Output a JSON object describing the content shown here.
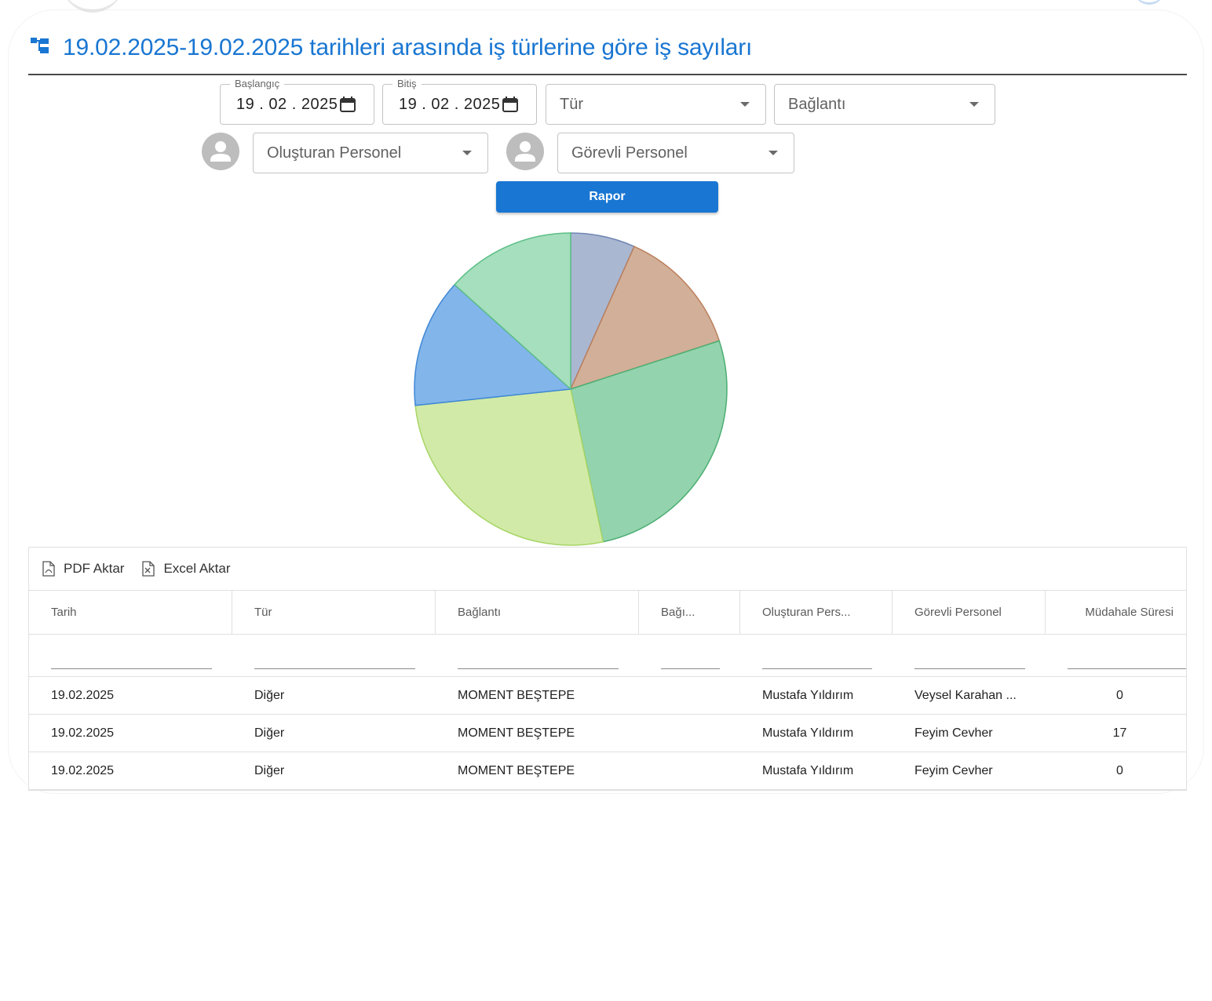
{
  "header": {
    "title": "19.02.2025-19.02.2025 tarihleri arasında iş türlerine göre iş sayıları",
    "icon": "hierarchy-icon"
  },
  "filters": {
    "start_label": "Başlangıç",
    "start_value": "19 . 02 . 2025",
    "end_label": "Bitiş",
    "end_value": "19 . 02 . 2025",
    "type_placeholder": "Tür",
    "connection_placeholder": "Bağlantı",
    "creator_placeholder": "Oluşturan Personel",
    "assignee_placeholder": "Görevli Personel",
    "report_button": "Rapor"
  },
  "chart_data": {
    "type": "pie",
    "values": [
      1,
      2,
      4,
      4,
      2,
      2
    ],
    "colors": [
      "#aab7d1",
      "#d2af98",
      "#93d3ae",
      "#d2eaa8",
      "#82b5ea",
      "#a6dfbd"
    ],
    "stroke_colors": [
      "#6f86b3",
      "#bb7f5c",
      "#4cae72",
      "#a6d565",
      "#3f88d6",
      "#5cbf86"
    ]
  },
  "toolbar": {
    "pdf_label": "PDF Aktar",
    "excel_label": "Excel Aktar"
  },
  "table": {
    "columns": [
      "Tarih",
      "Tür",
      "Bağlantı",
      "Bağı...",
      "Oluşturan Pers...",
      "Görevli Personel",
      "Müdahale Süresi"
    ],
    "rows": [
      [
        "19.02.2025",
        "Diğer",
        "MOMENT BEŞTEPE",
        "",
        "Mustafa Yıldırım",
        "Veysel Karahan ...",
        "0"
      ],
      [
        "19.02.2025",
        "Diğer",
        "MOMENT BEŞTEPE",
        "",
        "Mustafa Yıldırım",
        "Feyim Cevher",
        "17"
      ],
      [
        "19.02.2025",
        "Diğer",
        "MOMENT BEŞTEPE",
        "",
        "Mustafa Yıldırım",
        "Feyim Cevher",
        "0"
      ]
    ]
  }
}
